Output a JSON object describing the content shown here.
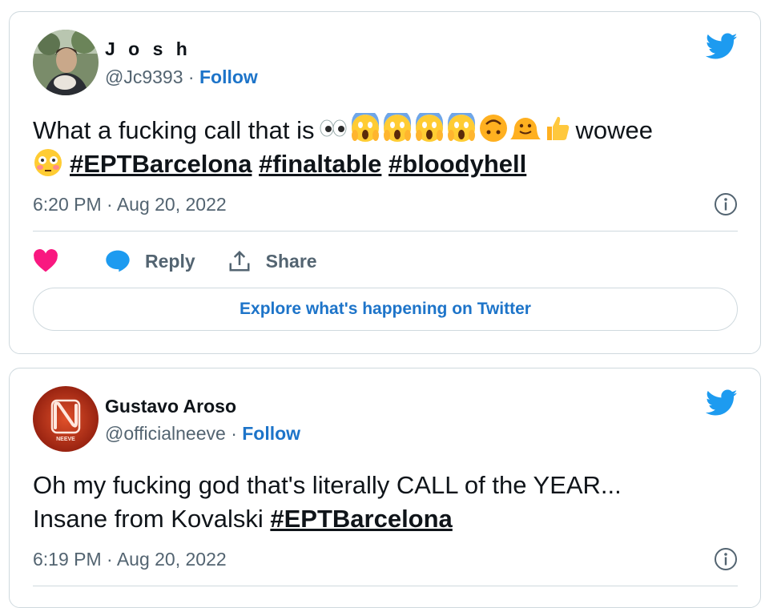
{
  "tweets": [
    {
      "name": "J o s h",
      "handle": "@Jc9393",
      "separator": "·",
      "follow_label": "Follow",
      "text_before": "What a fucking call that is",
      "emojis": [
        "eyes",
        "scream",
        "scream",
        "scream",
        "scream",
        "upside-down",
        "melting",
        "thumbs-up"
      ],
      "text_after": "wowee",
      "emoji_line2": "flushed",
      "hashtags": [
        "#EPTBarcelona",
        "#finaltable",
        "#bloodyhell"
      ],
      "timestamp": "6:20 PM · Aug 20, 2022",
      "reply_label": "Reply",
      "share_label": "Share",
      "explore_label": "Explore what's happening on Twitter"
    },
    {
      "name": "Gustavo Aroso",
      "handle": "@officialneeve",
      "separator": "·",
      "follow_label": "Follow",
      "avatar_text": "NEEVE",
      "text_line1": "Oh my fucking god that's literally CALL of the YEAR...",
      "text_line2": "Insane from Kovalski",
      "hashtag": "#EPTBarcelona",
      "timestamp": "6:19 PM · Aug 20, 2022"
    }
  ],
  "colors": {
    "accent": "#1d74c9",
    "twitter_blue": "#1d9bf0",
    "like": "#f91880",
    "muted": "#536471",
    "border": "#cfd9de"
  }
}
